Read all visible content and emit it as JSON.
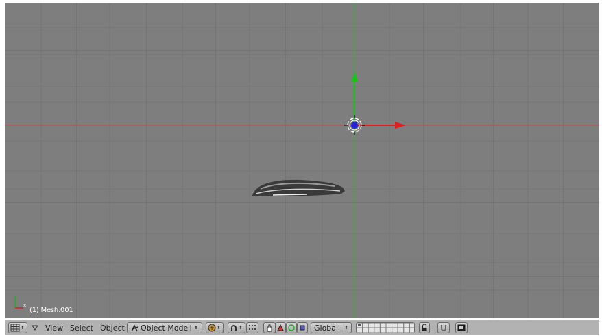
{
  "viewport": {
    "object_label": "(1) Mesh.001",
    "axis_colors": {
      "x": "#d62020",
      "y": "#18b818"
    },
    "grid_color": "#727272",
    "background": "#7e7e7e"
  },
  "header": {
    "editor_type_icon": "grid-icon",
    "menus": [
      "View",
      "Select",
      "Object"
    ],
    "mode": {
      "icon": "object-mode-icon",
      "label": "Object Mode"
    },
    "draw_type_icon": "solid-shading-icon",
    "pivot_icon": "pivot-icon",
    "manipulator_icons": [
      "hand-icon",
      "translate-icon",
      "rotate-icon",
      "scale-icon"
    ],
    "orientation": "Global",
    "lock_icon": "lock-icon",
    "snap_icon": "magnet-icon",
    "render_icon": "render-icon"
  }
}
